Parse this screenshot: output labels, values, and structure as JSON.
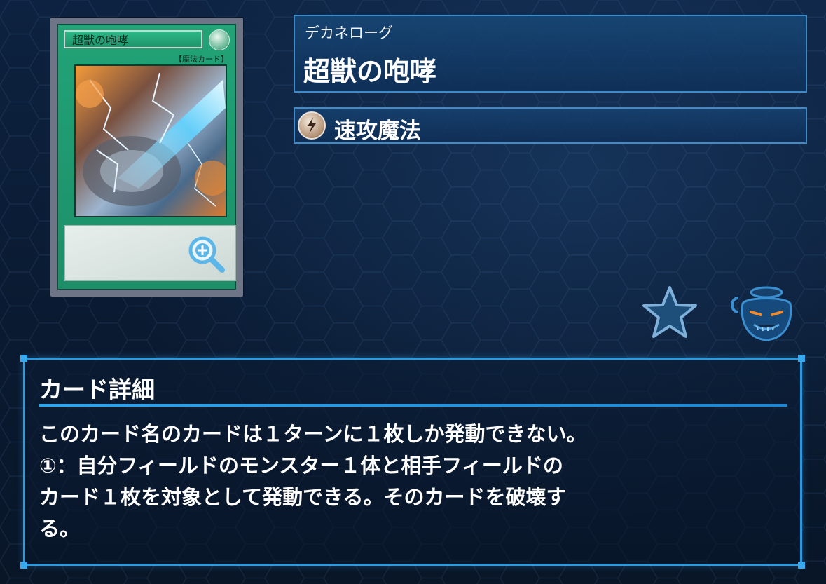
{
  "card": {
    "image_title": "超獣の咆哮",
    "image_type_line": "【魔法カード】",
    "zoom_icon": "magnifier-plus-icon"
  },
  "header": {
    "ruby": "デカネローグ",
    "name": "超獣の咆哮"
  },
  "type": {
    "icon": "quick-play-spell-icon",
    "label": "速攻魔法"
  },
  "actions": {
    "favorite_icon": "star-icon",
    "pot_icon": "pot-of-greed-icon"
  },
  "detail": {
    "title": "カード詳細",
    "lines": [
      "このカード名のカードは１ターンに１枚しか発動できない。",
      "①：自分フィールドのモンスター１体と相手フィールドの",
      "カード１枚を対象として発動できる。そのカードを破壊す",
      "る。"
    ]
  },
  "colors": {
    "background": "#0b1c33",
    "panel_border": "#2a9be0",
    "card_frame_green": "#1f956c"
  }
}
